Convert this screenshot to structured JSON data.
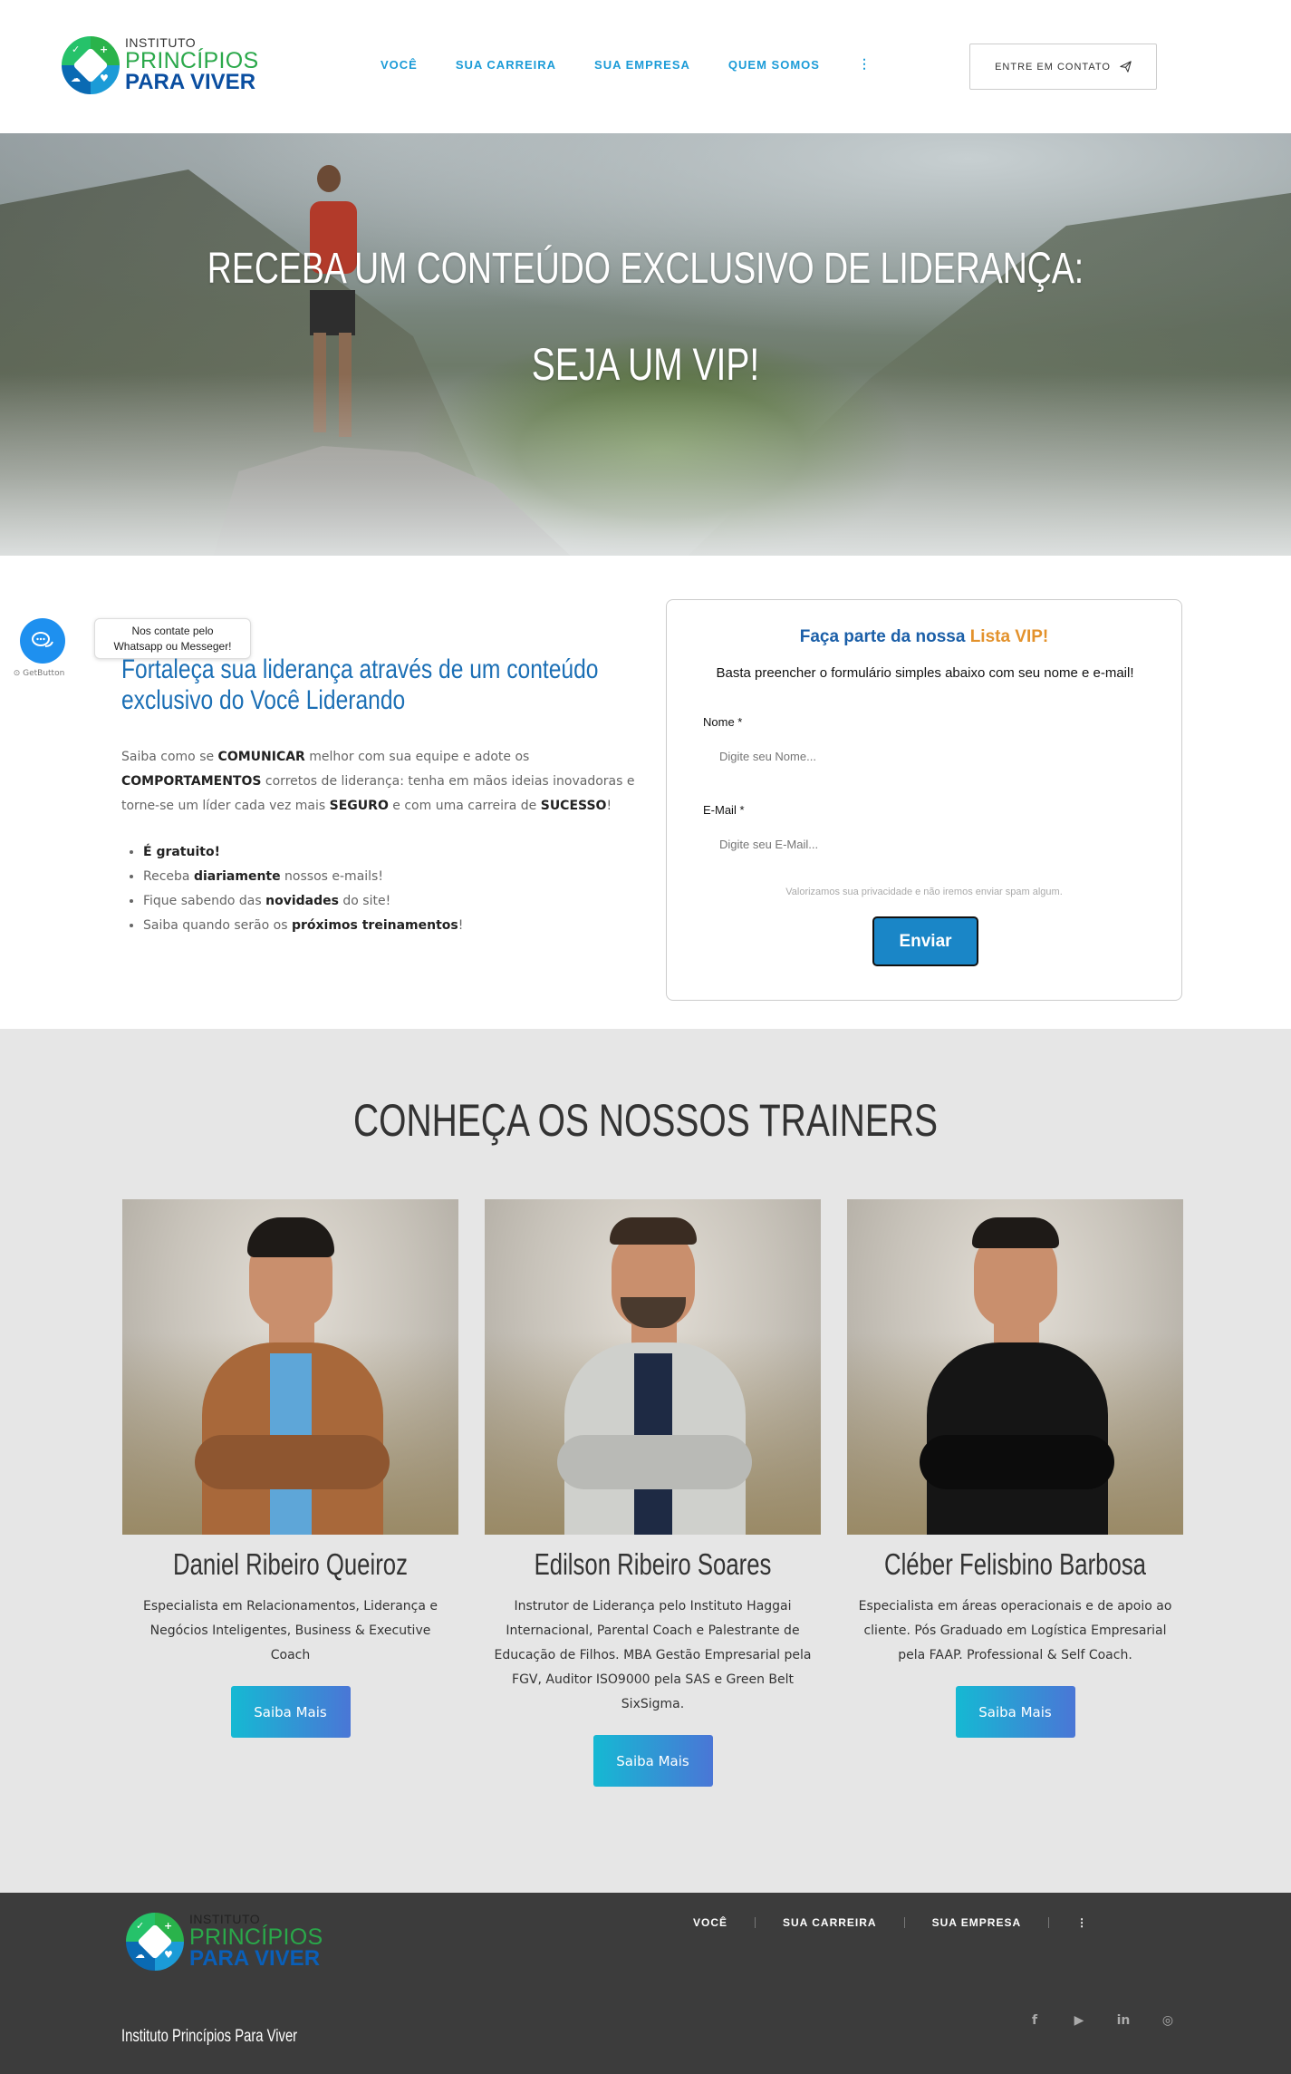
{
  "header": {
    "logo": {
      "line1": "INSTITUTO",
      "line2": "PRINCÍPIOS",
      "line3": "PARA VIVER"
    },
    "nav": [
      "VOCÊ",
      "SUA CARREIRA",
      "SUA EMPRESA",
      "QUEM SOMOS"
    ],
    "more_icon": "⋮",
    "contact_label": "ENTRE EM CONTATO",
    "contact_icon": "paper-plane-icon"
  },
  "hero": {
    "line1": "RECEBA UM CONTEÚDO EXCLUSIVO DE LIDERANÇA:",
    "line2": "SEJA UM VIP!"
  },
  "chat": {
    "label": "GetButton",
    "tooltip_line1": "Nos contate pelo",
    "tooltip_line2": "Whatsapp ou Messeger!"
  },
  "vip": {
    "heading": "Fortaleça sua liderança através de um conteúdo exclusivo do Você Liderando",
    "intro_1": "Saiba como se ",
    "intro_b1": "COMUNICAR",
    "intro_2": " melhor com sua equipe e adote os ",
    "intro_b2": "COMPORTAMENTOS",
    "intro_3": " corretos de liderança: tenha em mãos ideias inovadoras e torne-se um líder cada vez mais ",
    "intro_b3": "SEGURO",
    "intro_4": " e com uma carreira de ",
    "intro_b4": "SUCESSO",
    "intro_5": "!",
    "bullets": [
      {
        "pre": "",
        "bold": "É gratuito!",
        "post": ""
      },
      {
        "pre": "Receba ",
        "bold": "diariamente",
        "post": " nossos e-mails!"
      },
      {
        "pre": "Fique sabendo das ",
        "bold": "novidades",
        "post": " do site!"
      },
      {
        "pre": "Saiba quando serão os ",
        "bold": "próximos treinamentos",
        "post": "!"
      }
    ]
  },
  "form": {
    "title_pre": "Faça parte da nossa ",
    "title_hl": "Lista VIP!",
    "subtitle": "Basta preencher o formulário simples abaixo com seu nome e e-mail!",
    "name_label": "Nome *",
    "name_placeholder": "Digite seu Nome...",
    "email_label": "E-Mail *",
    "email_placeholder": "Digite seu E-Mail...",
    "privacy": "Valorizamos sua privacidade e não iremos enviar spam algum.",
    "submit": "Enviar"
  },
  "trainers": {
    "title": "CONHEÇA OS NOSSOS TRAINERS",
    "people": [
      {
        "name": "Daniel Ribeiro Queiroz",
        "bio": "Especialista em Relacionamentos, Liderança e Negócios Inteligentes, Business & Executive Coach",
        "button": "Saiba Mais",
        "jacket": "#a8683a",
        "shirt": "#5ea6d8"
      },
      {
        "name": "Edilson Ribeiro Soares",
        "bio": "Instrutor de Liderança pelo Instituto Haggai Internacional, Parental Coach e Palestrante de Educação de Filhos. MBA Gestão Empresarial pela FGV, Auditor ISO9000 pela SAS e Green Belt SixSigma.",
        "button": "Saiba Mais",
        "jacket": "#cfd0cc",
        "shirt": "#1e2a44"
      },
      {
        "name": "Cléber Felisbino Barbosa",
        "bio": "Especialista em áreas operacionais e de apoio ao cliente. Pós Graduado em Logística Empresarial pela FAAP. Professional & Self Coach.",
        "button": "Saiba Mais",
        "jacket": "#151515",
        "shirt": "#1c1c1c"
      }
    ]
  },
  "footer": {
    "nav": [
      "VOCÊ",
      "SUA CARREIRA",
      "SUA EMPRESA"
    ],
    "more_icon": "⋮",
    "brand": "Instituto Princípios Para Viver",
    "social": [
      {
        "icon": "facebook-icon",
        "glyph": "f"
      },
      {
        "icon": "youtube-icon",
        "glyph": "▶"
      },
      {
        "icon": "linkedin-icon",
        "glyph": "in"
      },
      {
        "icon": "instagram-icon",
        "glyph": "◎"
      }
    ]
  }
}
